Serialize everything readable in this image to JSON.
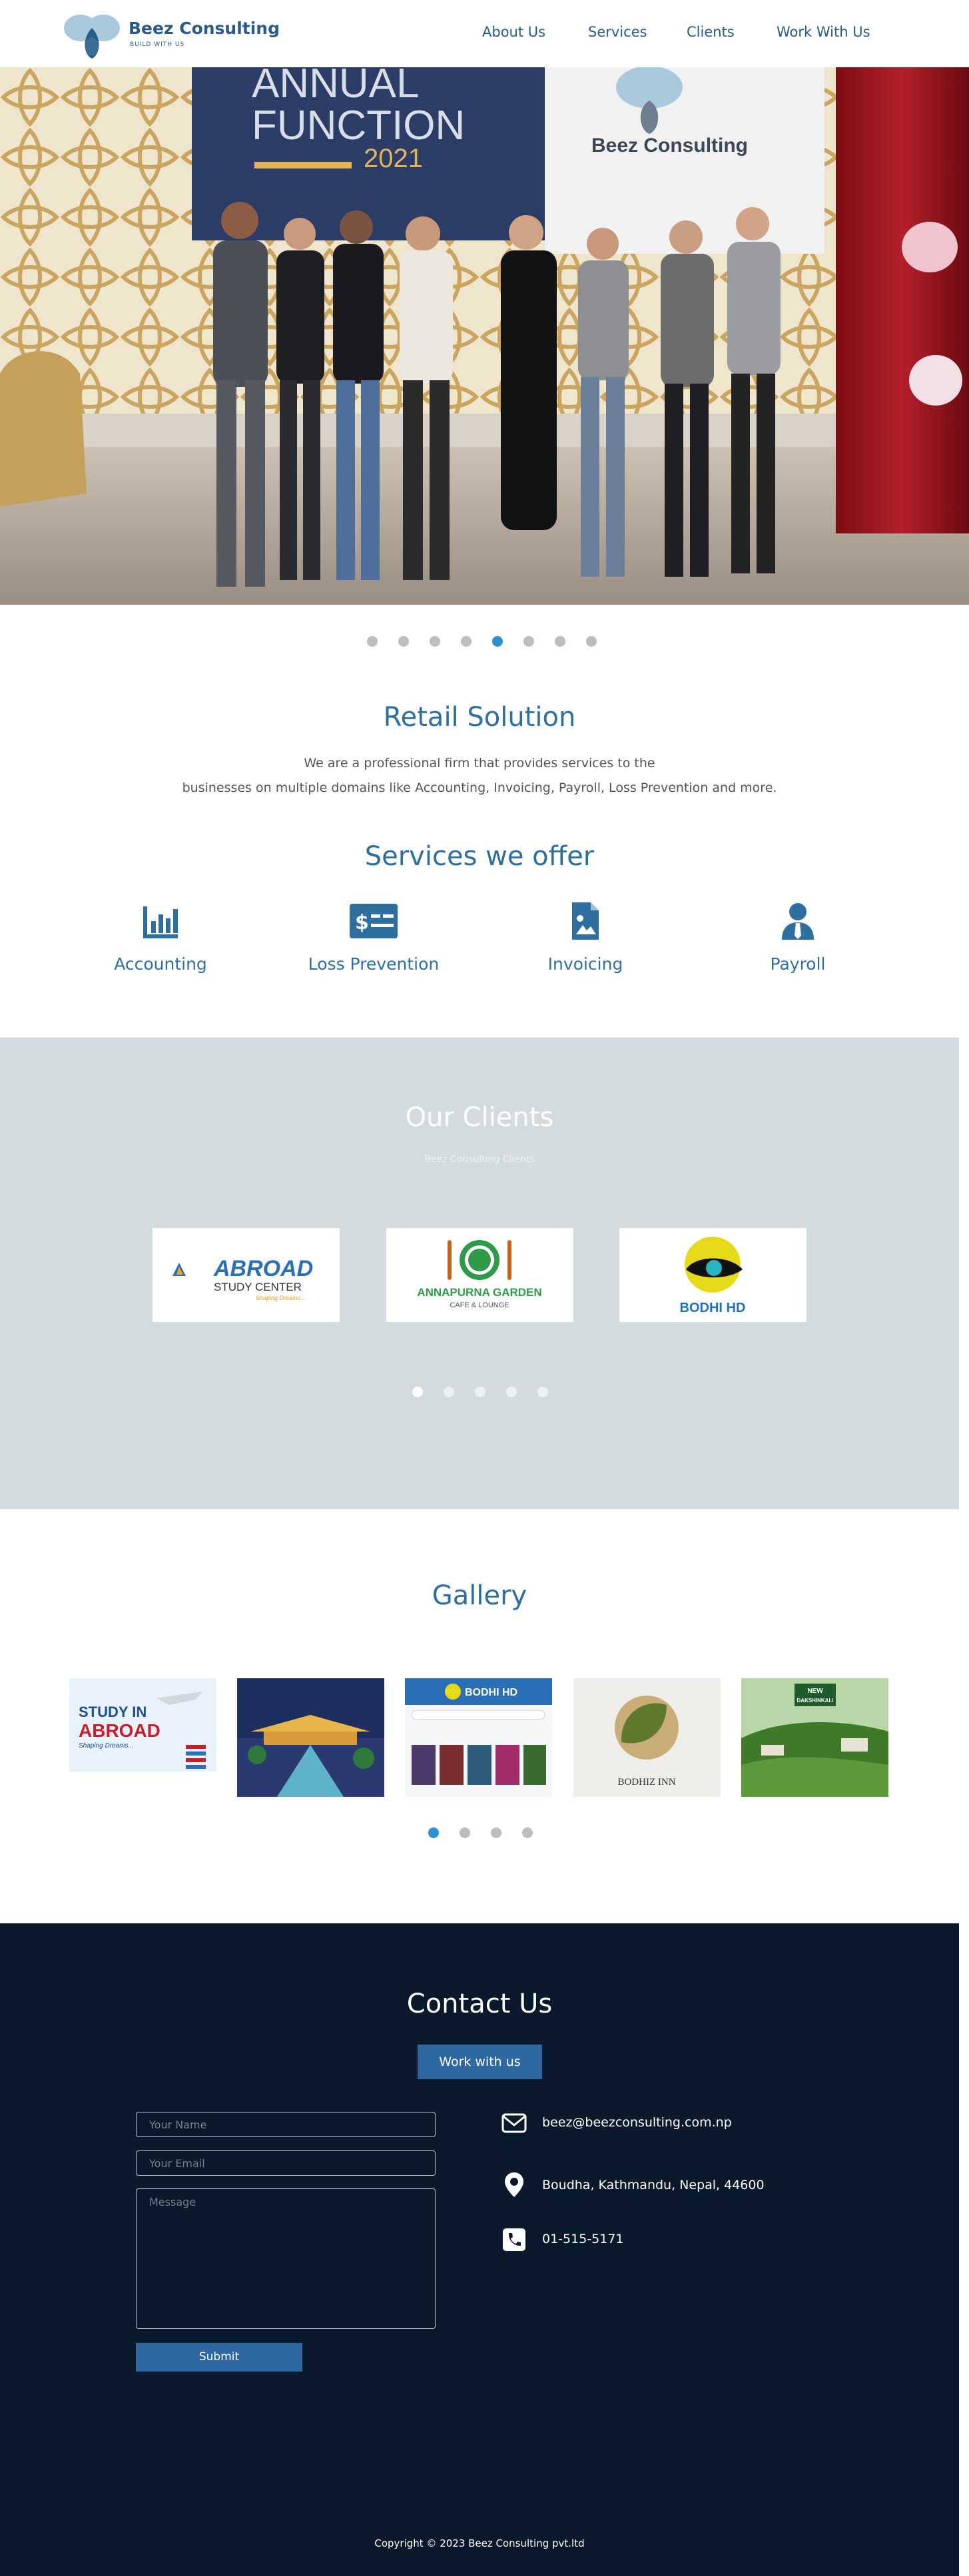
{
  "header": {
    "brand_name": "Beez Consulting",
    "brand_tagline": "BUILD WITH US",
    "nav": [
      "About Us",
      "Services",
      "Clients",
      "Work With Us"
    ]
  },
  "hero": {
    "banner_title_line1": "ANNUAL",
    "banner_title_line2": "FUNCTION",
    "banner_year": "2021",
    "banner_brand": "Beez Consulting",
    "slide_count": 8,
    "active_slide": 5
  },
  "retail": {
    "title": "Retail Solution",
    "line1": "We are a professional firm that provides services to the",
    "line2": "businesses on multiple domains like Accounting, Invoicing, Payroll, Loss Prevention and more."
  },
  "services": {
    "title": "Services we offer",
    "items": [
      {
        "label": "Accounting",
        "icon": "bar-chart-icon"
      },
      {
        "label": "Loss Prevention",
        "icon": "money-card-icon"
      },
      {
        "label": "Invoicing",
        "icon": "invoice-document-icon"
      },
      {
        "label": "Payroll",
        "icon": "person-tie-icon"
      }
    ]
  },
  "clients": {
    "title": "Our Clients",
    "subtitle": "Beez Consulting Clients",
    "logos": [
      {
        "line1": "ABROAD",
        "line2": "STUDY CENTER",
        "line3": "Shaping Dreams..."
      },
      {
        "line1": "ANNAPURNA GARDEN",
        "line2": "CAFE & LOUNGE"
      },
      {
        "line1": "BODHI HD"
      }
    ],
    "slide_count": 5,
    "active_slide": 1
  },
  "gallery": {
    "title": "Gallery",
    "tiles": [
      {
        "line1": "STUDY IN",
        "line2": "ABROAD",
        "line3": "Shaping Dreams..."
      },
      {
        "line1": ""
      },
      {
        "line1": "BODHI HD"
      },
      {
        "line1": "BODHIZ INN"
      },
      {
        "line1": "NEW",
        "line2": "DAKSHINKALI"
      }
    ],
    "slide_count": 4,
    "active_slide": 1
  },
  "contact": {
    "title": "Contact Us",
    "work_button": "Work with us",
    "name_placeholder": "Your Name",
    "email_placeholder": "Your Email",
    "message_placeholder": "Message",
    "submit": "Submit",
    "email": "beez@beezconsulting.com.np",
    "address": "Boudha, Kathmandu, Nepal, 44600",
    "phone": "01-515-5171",
    "copyright": "Copyright © 2023 Beez Consulting pvt.ltd"
  },
  "colors": {
    "brand_blue": "#2f6f9f",
    "nav_blue": "#2a5a86",
    "button_blue": "#2f67a3",
    "clients_bg": "#d3dbde",
    "footer_bg": "#0a192b",
    "active_dot": "#2f8fd0"
  }
}
